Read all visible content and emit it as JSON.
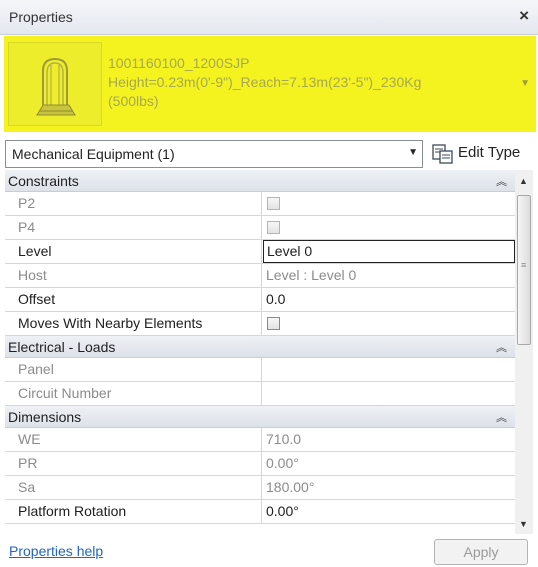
{
  "window": {
    "title": "Properties",
    "close_glyph": "×"
  },
  "type_selector": {
    "name_lines": [
      "1001160100_1200SJP",
      "Height=0.23m(0'-9\")_Reach=7.13m(23'-5\")_230Kg",
      "(500lbs)"
    ],
    "thumbnail_icon": "equipment-preview-icon",
    "highlight_color": "#f5f31f"
  },
  "category_selector": {
    "value": "Mechanical Equipment (1)",
    "edit_type_label": "Edit Type"
  },
  "sections": [
    {
      "title": "Constraints",
      "rows": [
        {
          "name": "P2",
          "type": "checkbox",
          "dim": true
        },
        {
          "name": "P4",
          "type": "checkbox",
          "dim": true
        },
        {
          "name": "Level",
          "value": "Level 0",
          "editing": true
        },
        {
          "name": "Host",
          "value": "Level : Level 0",
          "dim": true
        },
        {
          "name": "Offset",
          "value": "0.0"
        },
        {
          "name": "Moves With Nearby Elements",
          "type": "checkbox"
        }
      ]
    },
    {
      "title": "Electrical - Loads",
      "rows": [
        {
          "name": "Panel",
          "value": "",
          "dim": true
        },
        {
          "name": "Circuit Number",
          "value": "",
          "dim": true
        }
      ]
    },
    {
      "title": "Dimensions",
      "rows": [
        {
          "name": "WE",
          "value": "710.0",
          "dim": true
        },
        {
          "name": "PR",
          "value": "0.00°",
          "dim": true
        },
        {
          "name": "Sa",
          "value": "180.00°",
          "dim": true
        },
        {
          "name": "Platform Rotation",
          "value": "0.00°"
        }
      ]
    }
  ],
  "footer": {
    "help_link": "Properties help",
    "apply_label": "Apply"
  }
}
